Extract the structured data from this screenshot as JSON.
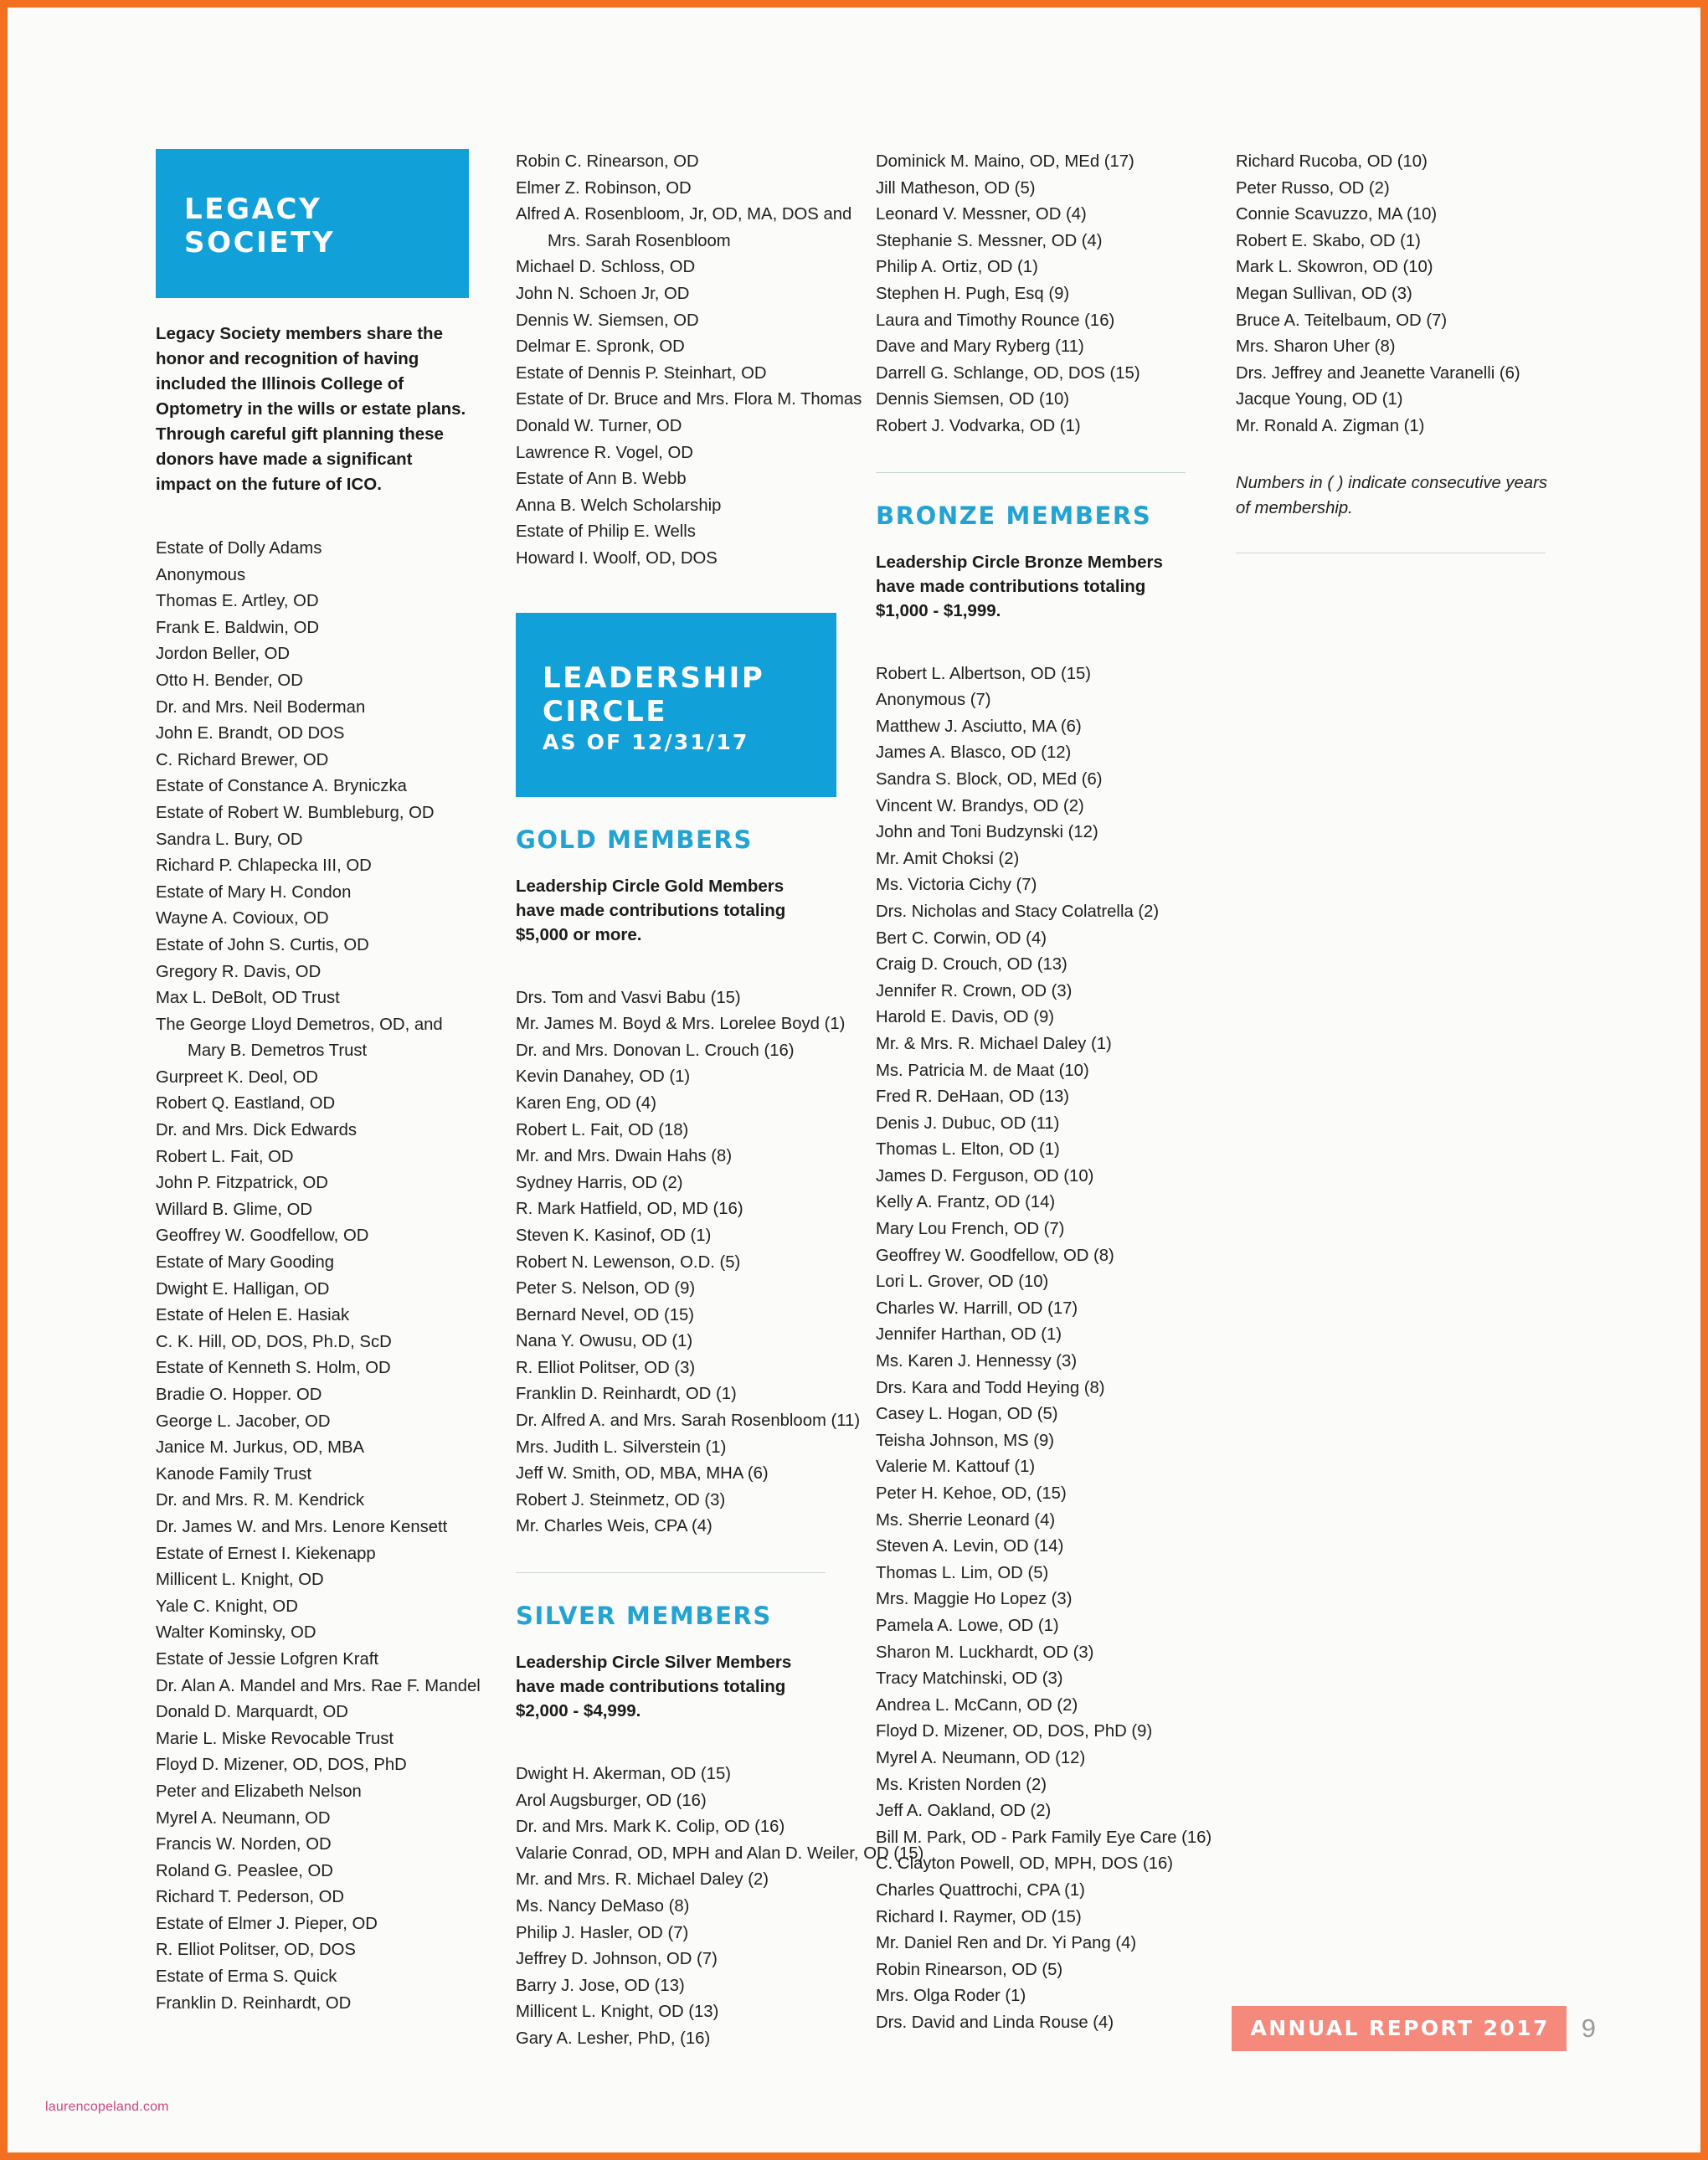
{
  "document": {
    "footer_badge": "ANNUAL REPORT 2017",
    "page_number": "9",
    "watermark": "laurencopeland.com"
  },
  "legacy": {
    "banner_line1": "LEGACY",
    "banner_line2": "SOCIETY",
    "intro": "Legacy Society members share the honor and recognition of having included the Illinois College of Optometry in the wills or estate plans. Through careful gift planning these donors have made a significant impact on the future of ICO.",
    "names_col1": [
      "Estate of Dolly Adams",
      "Anonymous",
      "Thomas E. Artley, OD",
      "Frank E. Baldwin, OD",
      "Jordon Beller, OD",
      "Otto H. Bender, OD",
      "Dr. and Mrs. Neil Boderman",
      "John E. Brandt, OD DOS",
      "C. Richard Brewer, OD",
      "Estate of Constance A. Bryniczka",
      "Estate of Robert W. Bumbleburg, OD",
      "Sandra L. Bury, OD",
      "Richard P. Chlapecka III, OD",
      "Estate of Mary H. Condon",
      "Wayne A. Covioux, OD",
      "Estate of John S. Curtis, OD",
      "Gregory R. Davis, OD",
      "Max L.  DeBolt, OD Trust",
      "The George Lloyd Demetros, OD, and",
      "Mary B. Demetros Trust",
      "Gurpreet K. Deol, OD",
      "Robert Q. Eastland, OD",
      "Dr. and Mrs. Dick Edwards",
      "Robert L. Fait, OD",
      "John P. Fitzpatrick, OD",
      "Willard B. Glime, OD",
      "Geoffrey W. Goodfellow, OD",
      "Estate of Mary Gooding",
      "Dwight E. Halligan, OD",
      "Estate of Helen E. Hasiak",
      "C. K. Hill, OD, DOS, Ph.D, ScD",
      "Estate of Kenneth S. Holm, OD",
      "Bradie O. Hopper. OD",
      "George L. Jacober, OD",
      "Janice M. Jurkus, OD, MBA",
      "Kanode Family Trust",
      "Dr. and Mrs. R. M. Kendrick",
      "Dr. James W. and Mrs. Lenore Kensett",
      "Estate of Ernest I. Kiekenapp",
      "Millicent L. Knight, OD",
      "Yale C. Knight, OD",
      "Walter Kominsky, OD",
      "Estate of Jessie Lofgren Kraft",
      "Dr. Alan A. Mandel and Mrs. Rae F. Mandel",
      "Donald D. Marquardt, OD",
      "Marie L. Miske Revocable Trust",
      "Floyd D. Mizener, OD, DOS, PhD",
      "Peter and Elizabeth Nelson",
      "Myrel A. Neumann, OD",
      "Francis W. Norden, OD",
      "Roland G. Peaslee, OD",
      "Richard T. Pederson, OD",
      "Estate of Elmer J. Pieper, OD",
      "R. Elliot Politser, OD, DOS",
      "Estate of Erma S. Quick",
      "Franklin D. Reinhardt, OD"
    ],
    "indent_index_col1": 19,
    "names_col2": [
      "Robin C. Rinearson, OD",
      "Elmer Z. Robinson, OD",
      "Alfred A. Rosenbloom, Jr, OD, MA, DOS and",
      "Mrs. Sarah Rosenbloom",
      "Michael D. Schloss, OD",
      "John N. Schoen Jr, OD",
      "Dennis W. Siemsen, OD",
      "Delmar E. Spronk, OD",
      "Estate of Dennis P. Steinhart, OD",
      "Estate of Dr. Bruce and Mrs. Flora M.  Thomas",
      "Donald W. Turner, OD",
      "Lawrence R. Vogel, OD",
      "Estate of Ann B. Webb",
      "Anna B. Welch Scholarship",
      "Estate of Philip E. Wells",
      "Howard I. Woolf, OD, DOS"
    ],
    "indent_index_col2": 3
  },
  "leadership": {
    "banner_line1": "LEADERSHIP",
    "banner_line2": "CIRCLE",
    "banner_sub": "AS OF 12/31/17"
  },
  "gold": {
    "heading": "GOLD MEMBERS",
    "description": "Leadership Circle Gold Members have made contributions totaling $5,000 or more.",
    "names": [
      "Drs. Tom and Vasvi Babu (15)",
      "Mr. James M. Boyd & Mrs. Lorelee Boyd (1)",
      "Dr. and Mrs. Donovan L. Crouch (16)",
      "Kevin Danahey, OD (1)",
      "Karen Eng, OD (4)",
      "Robert L. Fait, OD (18)",
      "Mr. and Mrs. Dwain Hahs (8)",
      "Sydney Harris, OD (2)",
      "R. Mark Hatfield, OD, MD (16)",
      "Steven K. Kasinof, OD (1)",
      "Robert N. Lewenson, O.D. (5)",
      "Peter S. Nelson, OD (9)",
      "Bernard Nevel, OD (15)",
      "Nana Y. Owusu, OD (1)",
      "R. Elliot Politser, OD (3)",
      "Franklin D. Reinhardt, OD (1)",
      "Dr. Alfred A. and Mrs. Sarah Rosenbloom (11)",
      "Mrs. Judith L. Silverstein (1)",
      "Jeff W. Smith, OD, MBA, MHA (6)",
      "Robert J. Steinmetz, OD (3)",
      "Mr. Charles Weis, CPA (4)"
    ]
  },
  "silver": {
    "heading": "SILVER MEMBERS",
    "description": "Leadership Circle Silver Members have made contributions totaling $2,000 - $4,999.",
    "names": [
      "Dwight H. Akerman, OD (15)",
      "Arol Augsburger, OD (16)",
      "Dr. and Mrs. Mark K. Colip, OD (16)",
      "Valarie Conrad, OD, MPH and Alan D. Weiler, OD (15)",
      "Mr. and Mrs. R. Michael Daley (2)",
      "Ms. Nancy DeMaso (8)",
      "Philip J. Hasler, OD (7)",
      "Jeffrey D. Johnson, OD (7)",
      "Barry J. Jose, OD (13)",
      "Millicent L. Knight, OD (13)",
      "Gary A. Lesher, PhD, (16)"
    ]
  },
  "bronze": {
    "heading": "BRONZE MEMBERS",
    "description": "Leadership Circle Bronze Members have made contributions totaling $1,000 - $1,999.",
    "names_continued_col3_top": [
      "Dominick M. Maino, OD, MEd (17)",
      "Jill Matheson, OD (5)",
      "Leonard V. Messner, OD (4)",
      "Stephanie S. Messner, OD (4)",
      "Philip A. Ortiz, OD (1)",
      "Stephen H. Pugh, Esq (9)",
      "Laura and Timothy Rounce (16)",
      "Dave and Mary Ryberg (11)",
      "Darrell G. Schlange, OD, DOS (15)",
      "Dennis Siemsen, OD (10)",
      "Robert J. Vodvarka, OD (1)"
    ],
    "names": [
      "Robert L. Albertson, OD (15)",
      "Anonymous (7)",
      "Matthew J. Asciutto, MA (6)",
      "James A. Blasco, OD (12)",
      "Sandra S. Block, OD, MEd (6)",
      "Vincent W. Brandys, OD (2)",
      "John and Toni Budzynski (12)",
      "Mr. Amit Choksi (2)",
      "Ms. Victoria Cichy (7)",
      "Drs. Nicholas and Stacy Colatrella (2)",
      "Bert C. Corwin, OD (4)",
      "Craig D. Crouch, OD (13)",
      "Jennifer R. Crown, OD (3)",
      "Harold E. Davis, OD (9)",
      "Mr. & Mrs. R. Michael Daley (1)",
      "Ms. Patricia M. de Maat (10)",
      "Fred R. DeHaan, OD (13)",
      "Denis J. Dubuc, OD (11)",
      "Thomas L. Elton, OD (1)",
      "James D. Ferguson, OD (10)",
      "Kelly A. Frantz, OD (14)",
      "Mary Lou French, OD (7)",
      "Geoffrey W. Goodfellow, OD (8)",
      "Lori L. Grover, OD (10)",
      "Charles W. Harrill, OD (17)",
      "Jennifer Harthan, OD (1)",
      "Ms. Karen J. Hennessy (3)",
      "Drs. Kara and Todd Heying (8)",
      "Casey L. Hogan, OD (5)",
      "Teisha Johnson, MS (9)",
      "Valerie M. Kattouf (1)",
      "Peter H. Kehoe, OD, (15)",
      "Ms. Sherrie Leonard (4)",
      "Steven A. Levin, OD (14)",
      "Thomas L. Lim, OD (5)",
      "Mrs. Maggie Ho Lopez (3)",
      "Pamela A. Lowe, OD (1)",
      "Sharon M. Luckhardt, OD (3)",
      "Tracy Matchinski, OD (3)",
      "Andrea L. McCann, OD (2)",
      "Floyd D. Mizener, OD, DOS, PhD (9)",
      "Myrel A. Neumann, OD (12)",
      "Ms. Kristen Norden (2)",
      "Jeff A. Oakland, OD (2)",
      "Bill M. Park, OD  - Park Family Eye Care (16)",
      "C. Clayton Powell, OD, MPH, DOS (16)",
      "Charles Quattrochi, CPA (1)",
      "Richard I. Raymer, OD (15)",
      "Mr. Daniel Ren and Dr. Yi Pang (4)",
      "Robin Rinearson, OD (5)",
      "Mrs. Olga Roder (1)",
      "Drs. David and Linda Rouse (4)"
    ],
    "names_col4": [
      "Richard Rucoba, OD (10)",
      "Peter Russo, OD (2)",
      "Connie Scavuzzo, MA (10)",
      "Robert E. Skabo, OD (1)",
      "Mark L. Skowron, OD (10)",
      "Megan Sullivan, OD (3)",
      "Bruce A. Teitelbaum, OD (7)",
      "Mrs. Sharon Uher (8)",
      "Drs. Jeffrey and Jeanette Varanelli (6)",
      "Jacque Young, OD (1)",
      "Mr. Ronald A. Zigman (1)"
    ],
    "note": "Numbers in ( ) indicate consecutive years of membership."
  },
  "colors": {
    "brand_blue": "#11a0d8",
    "heading_blue": "#22a3d2",
    "badge_coral": "#f4897c",
    "page_border_orange": "#f37021"
  }
}
